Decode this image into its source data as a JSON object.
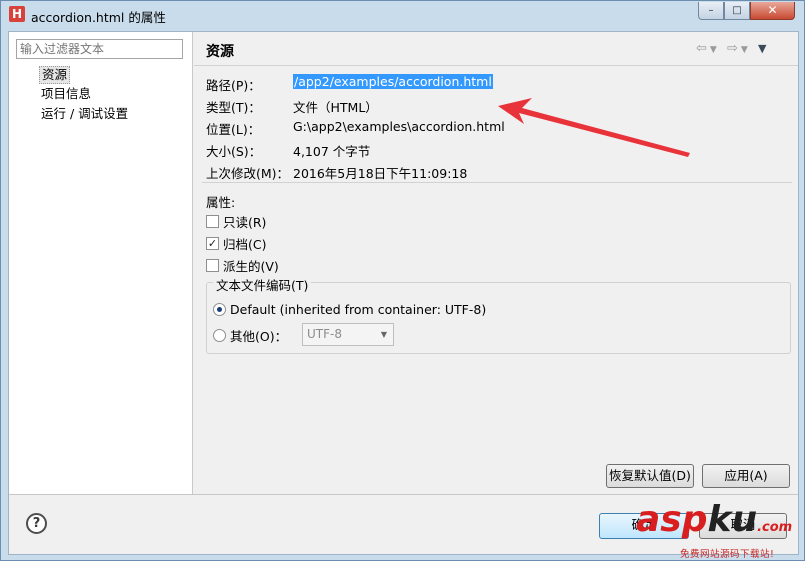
{
  "window": {
    "title": "accordion.html 的属性",
    "app_icon": "H",
    "controls": {
      "minimize": "–",
      "maximize": "□",
      "close": "✕"
    }
  },
  "filter": {
    "placeholder": "输入过滤器文本"
  },
  "tree": {
    "items": [
      {
        "label": "资源",
        "selected": true
      },
      {
        "label": "项目信息",
        "selected": false
      },
      {
        "label": "运行 / 调试设置",
        "selected": false
      }
    ]
  },
  "page": {
    "title": "资源",
    "nav_icons": [
      "back-arrow-icon",
      "back-menu-icon",
      "forward-arrow-icon",
      "forward-menu-icon",
      "view-menu-icon"
    ]
  },
  "properties": {
    "path": {
      "label": "路径(P)：",
      "value": "/app2/examples/accordion.html"
    },
    "type": {
      "label": "类型(T)：",
      "value": "文件（HTML）"
    },
    "location": {
      "label": "位置(L)：",
      "value": "G:\\app2\\examples\\accordion.html"
    },
    "size": {
      "label": "大小(S)：",
      "value": "4,107  个字节"
    },
    "modified": {
      "label": "上次修改(M)：",
      "value": "2016年5月18日下午11:09:18"
    }
  },
  "attributes": {
    "title": "属性:",
    "readonly": {
      "label": "只读(R)",
      "checked": false
    },
    "archive": {
      "label": "归档(C)",
      "checked": true
    },
    "derived": {
      "label": "派生的(V)",
      "checked": false
    }
  },
  "encoding": {
    "title": "文本文件编码(T)",
    "default_label": "Default (inherited from container: UTF-8)",
    "other_label": "其他(O)：",
    "selected_option": "default",
    "other_value": "UTF-8"
  },
  "buttons": {
    "restore_defaults": "恢复默认值(D)",
    "apply": "应用(A)",
    "ok": "确定",
    "cancel": "取消"
  },
  "help_icon": "?",
  "watermark": {
    "logo_a": "asp",
    "logo_k": "ku",
    "logo_c": ".com",
    "subtitle": "免费网站源码下载站!"
  },
  "colors": {
    "selection": "#3399ff",
    "arrow": "#e8333a",
    "watermark": "#d81e1e"
  }
}
